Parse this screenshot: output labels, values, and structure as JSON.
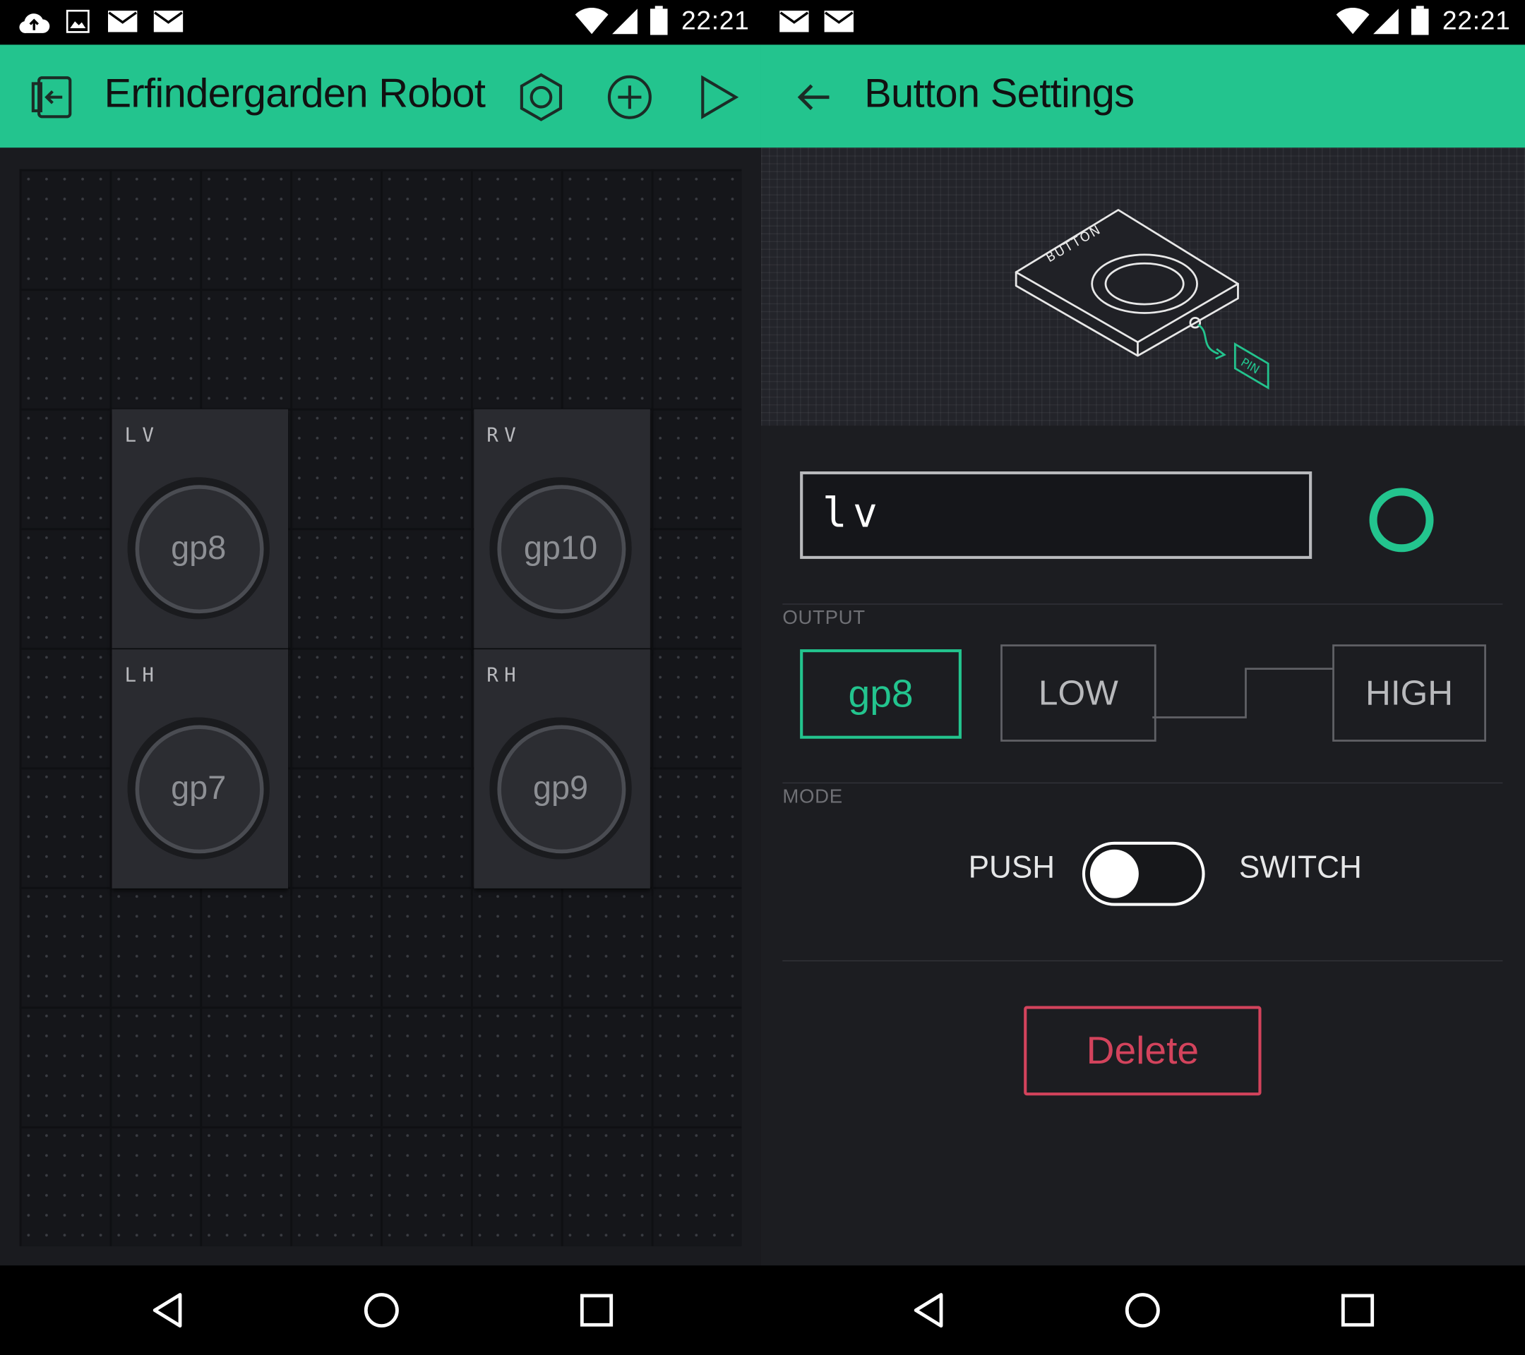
{
  "left_screen": {
    "status_bar": {
      "time": "22:21",
      "icons": [
        "cloud-upload-icon",
        "image-icon",
        "mail-icon",
        "mail-icon",
        "wifi-icon",
        "signal-icon",
        "battery-icon"
      ]
    },
    "app_bar": {
      "title": "Erfindergarden Robot",
      "actions": [
        "exit-icon",
        "settings-hex-icon",
        "add-icon",
        "play-icon"
      ]
    },
    "widgets": [
      {
        "label": "LV",
        "pin": "gp8"
      },
      {
        "label": "RV",
        "pin": "gp10"
      },
      {
        "label": "LH",
        "pin": "gp7"
      },
      {
        "label": "RH",
        "pin": "gp9"
      }
    ]
  },
  "right_screen": {
    "status_bar": {
      "time": "22:21",
      "icons": [
        "mail-icon",
        "mail-icon",
        "wifi-icon",
        "signal-icon",
        "battery-icon"
      ]
    },
    "app_bar": {
      "title": "Button Settings",
      "back_icon": "arrow-left-icon"
    },
    "illustration": {
      "button_text": "BUTTON",
      "pin_text": "PIN"
    },
    "name_field": {
      "value": "lv"
    },
    "output": {
      "section_label": "OUTPUT",
      "pin": "gp8",
      "low_label": "LOW",
      "high_label": "HIGH"
    },
    "mode": {
      "section_label": "MODE",
      "push_label": "PUSH",
      "switch_label": "SWITCH",
      "selected": "PUSH"
    },
    "delete_label": "Delete"
  },
  "colors": {
    "accent": "#23c48e",
    "danger": "#d3435c",
    "background": "#1c1d21",
    "appbar": "#23c48e"
  },
  "nav_bar": {
    "icons": [
      "back-triangle-icon",
      "home-circle-icon",
      "recents-square-icon"
    ]
  }
}
